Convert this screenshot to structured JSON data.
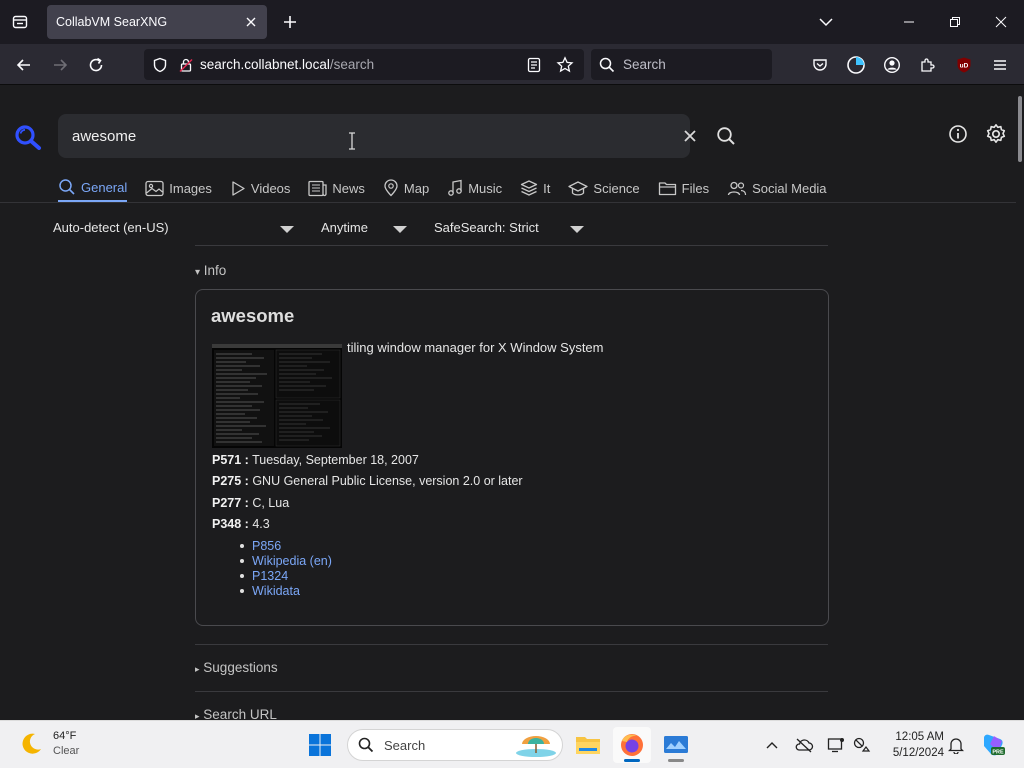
{
  "browser": {
    "tab_title": "CollabVM SearXNG",
    "url_host": "search.collabnet.local",
    "url_path": "/search",
    "search_placeholder": "Search"
  },
  "page": {
    "query": "awesome",
    "categories": [
      {
        "label": "General",
        "icon": "search-icon",
        "active": true
      },
      {
        "label": "Images",
        "icon": "image-icon",
        "active": false
      },
      {
        "label": "Videos",
        "icon": "play-icon",
        "active": false
      },
      {
        "label": "News",
        "icon": "newspaper-icon",
        "active": false
      },
      {
        "label": "Map",
        "icon": "map-pin-icon",
        "active": false
      },
      {
        "label": "Music",
        "icon": "music-icon",
        "active": false
      },
      {
        "label": "It",
        "icon": "layers-icon",
        "active": false
      },
      {
        "label": "Science",
        "icon": "school-icon",
        "active": false
      },
      {
        "label": "Files",
        "icon": "folder-icon",
        "active": false
      },
      {
        "label": "Social Media",
        "icon": "people-icon",
        "active": false
      }
    ],
    "filters": {
      "language": "Auto-detect (en-US)",
      "time": "Anytime",
      "safesearch": "SafeSearch: Strict"
    },
    "info_summary": "Info",
    "infobox": {
      "title": "awesome",
      "description": "tiling window manager for X Window System",
      "attributes": [
        {
          "key": "P571 :",
          "value": "Tuesday, September 18, 2007"
        },
        {
          "key": "P275 :",
          "value": "GNU General Public License, version 2.0 or later"
        },
        {
          "key": "P277 :",
          "value": "C, Lua"
        },
        {
          "key": "P348 :",
          "value": "4.3"
        }
      ],
      "links": [
        "P856",
        "Wikipedia (en)",
        "P1324",
        "Wikidata"
      ]
    },
    "suggestions_summary": "Suggestions",
    "search_url_summary": "Search URL"
  },
  "taskbar": {
    "temperature": "64°F",
    "condition": "Clear",
    "search_label": "Search",
    "time": "12:05 AM",
    "date": "5/12/2024"
  },
  "colors": {
    "accent": "#7ba7f7",
    "page_bg": "#1c1c1e",
    "logo_blue": "#3050ff"
  }
}
